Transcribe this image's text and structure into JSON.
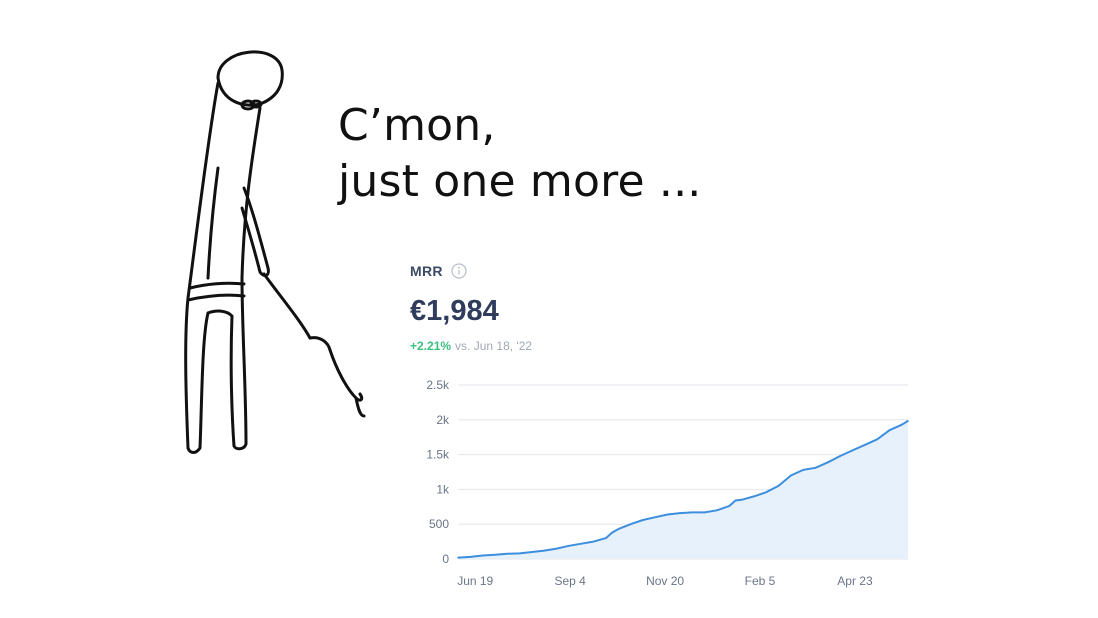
{
  "caption": {
    "line1": "C’mon,",
    "line2": "just one more ..."
  },
  "metric": {
    "title": "MRR",
    "value": "€1,984",
    "change": "+2.21%",
    "comparison": "vs. Jun 18, '22",
    "info_icon": "info-icon"
  },
  "colors": {
    "line": "#3d8fde",
    "area": "#e6f1fb",
    "grid": "#e3e6ec",
    "tick_text": "#6b7588",
    "positive": "#3bbf7f"
  },
  "chart_data": {
    "type": "area",
    "ylim": [
      0,
      2500
    ],
    "yticks": [
      0,
      500,
      1000,
      1500,
      2000,
      2500
    ],
    "ytick_labels": [
      "0",
      "500",
      "1k",
      "1.5k",
      "2k",
      "2.5k"
    ],
    "xtick_labels": [
      "Jun 19",
      "Sep 4",
      "Nov 20",
      "Feb 5",
      "Apr 23"
    ],
    "xtick_days": [
      1,
      78,
      155,
      232,
      309
    ],
    "grid": true,
    "series": [
      {
        "x": [
          0,
          10,
          20,
          30,
          40,
          50,
          60,
          70,
          80,
          90,
          100,
          110,
          120,
          125,
          130,
          140,
          150,
          160,
          170,
          180,
          190,
          200,
          210,
          220,
          225,
          230,
          240,
          250,
          260,
          270,
          280,
          290,
          300,
          310,
          320,
          330,
          340,
          350,
          360,
          365
        ],
        "y": [
          20,
          30,
          50,
          60,
          75,
          80,
          100,
          120,
          150,
          190,
          220,
          250,
          300,
          380,
          430,
          500,
          560,
          600,
          640,
          660,
          670,
          670,
          700,
          760,
          840,
          850,
          900,
          960,
          1050,
          1200,
          1280,
          1310,
          1390,
          1480,
          1560,
          1640,
          1720,
          1850,
          1930,
          1984
        ]
      }
    ]
  }
}
